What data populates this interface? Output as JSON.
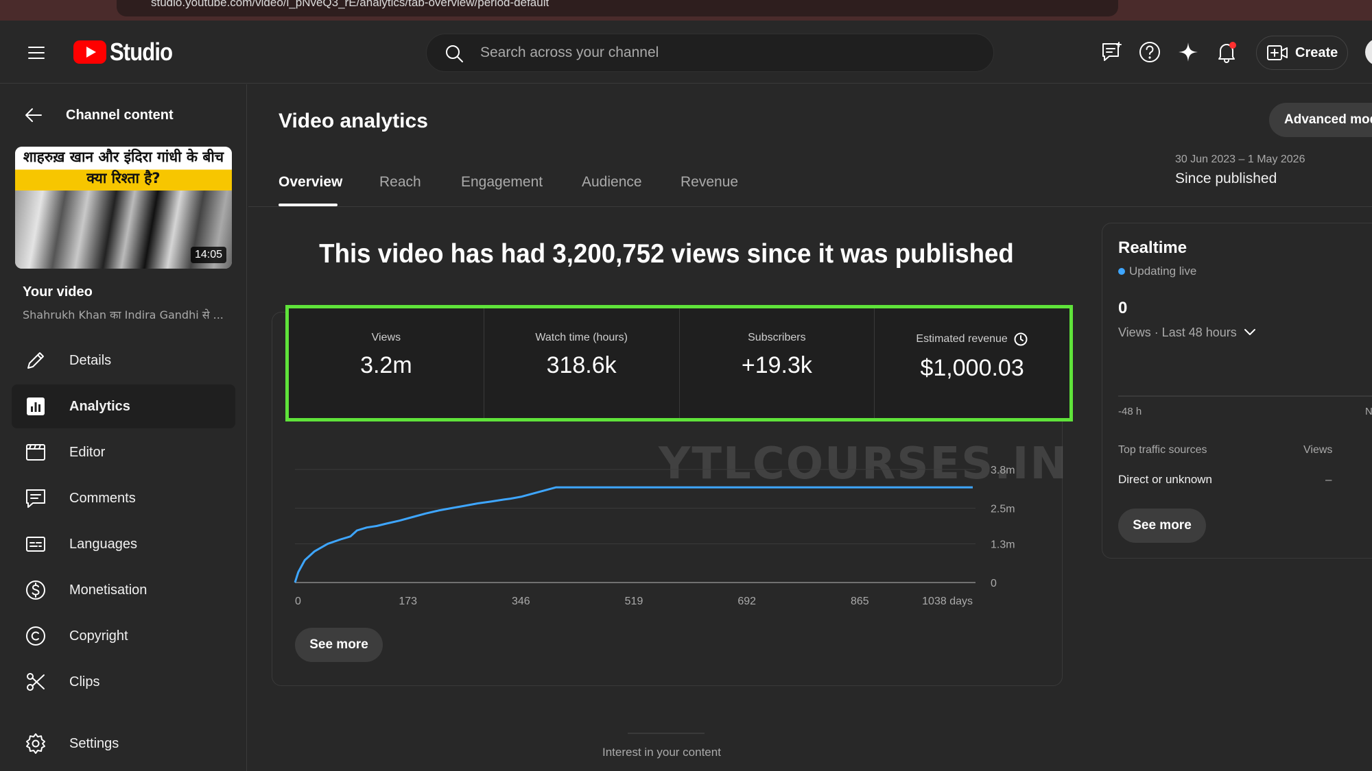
{
  "browser": {
    "url": "studio.youtube.com/video/l_pNveQ3_rE/analytics/tab-overview/period-default"
  },
  "header": {
    "logo_text": "Studio",
    "search_placeholder": "Search across your channel",
    "create_label": "Create",
    "brand_color": "#ff0000"
  },
  "sidebar": {
    "back_label": "Channel content",
    "thumbnail": {
      "title_line1": "शाहरुख़ खान और इंदिरा गांधी के बीच",
      "title_line2": "क्या रिश्ता है?",
      "duration": "14:05"
    },
    "your_video_label": "Your video",
    "video_title": "Shahrukh Khan का Indira Gandhi से ...",
    "items": [
      {
        "label": "Details",
        "icon": "pencil-icon",
        "active": false
      },
      {
        "label": "Analytics",
        "icon": "analytics-icon",
        "active": true
      },
      {
        "label": "Editor",
        "icon": "editor-icon",
        "active": false
      },
      {
        "label": "Comments",
        "icon": "comments-icon",
        "active": false
      },
      {
        "label": "Languages",
        "icon": "languages-icon",
        "active": false
      },
      {
        "label": "Monetisation",
        "icon": "monetisation-icon",
        "active": false
      },
      {
        "label": "Copyright",
        "icon": "copyright-icon",
        "active": false
      },
      {
        "label": "Clips",
        "icon": "scissors-icon",
        "active": false
      },
      {
        "label": "Settings",
        "icon": "gear-icon",
        "active": false
      }
    ]
  },
  "main": {
    "title": "Video analytics",
    "advanced_mode_label": "Advanced mod",
    "tabs": [
      {
        "label": "Overview",
        "active": true
      },
      {
        "label": "Reach",
        "active": false
      },
      {
        "label": "Engagement",
        "active": false
      },
      {
        "label": "Audience",
        "active": false
      },
      {
        "label": "Revenue",
        "active": false
      }
    ],
    "date_range": "30 Jun 2023 – 1 May 2026",
    "period": "Since published",
    "headline": "This video has had 3,200,752 views since it was published",
    "metrics": [
      {
        "label": "Views",
        "value": "3.2m"
      },
      {
        "label": "Watch time (hours)",
        "value": "318.6k"
      },
      {
        "label": "Subscribers",
        "value": "+19.3k"
      },
      {
        "label": "Estimated revenue",
        "value": "$1,000.03"
      }
    ],
    "see_more_label": "See more",
    "watermark": "YTLCOURSES.IN",
    "interest_label": "Interest in your content"
  },
  "chart_data": {
    "type": "line",
    "x_tick_labels": [
      "0",
      "173",
      "346",
      "519",
      "692",
      "865",
      "1038 days"
    ],
    "x_ticks": [
      0,
      173,
      346,
      519,
      692,
      865,
      1038
    ],
    "y_tick_labels": [
      "3.8m",
      "2.5m",
      "1.3m",
      "0"
    ],
    "y_ticks": [
      3.8,
      2.5,
      1.3,
      0
    ],
    "xlim": [
      0,
      1038
    ],
    "ylim": [
      0,
      3.8
    ],
    "y_unit": "m",
    "line_color": "#3ea6ff",
    "series": [
      {
        "values_x": [
          0,
          5,
          15,
          30,
          50,
          70,
          85,
          95,
          110,
          125,
          140,
          160,
          180,
          200,
          220,
          240,
          260,
          280,
          300,
          320,
          330,
          346,
          400,
          500,
          600,
          700,
          800,
          900,
          1000,
          1038
        ],
        "values_y": [
          0,
          0.35,
          0.75,
          1.05,
          1.3,
          1.45,
          1.55,
          1.75,
          1.85,
          1.9,
          1.98,
          2.08,
          2.2,
          2.32,
          2.42,
          2.5,
          2.58,
          2.66,
          2.72,
          2.79,
          2.82,
          2.88,
          3.2,
          3.2,
          3.2,
          3.2,
          3.2,
          3.2,
          3.2,
          3.2
        ]
      }
    ]
  },
  "realtime": {
    "title": "Realtime",
    "status": "Updating live",
    "value": "0",
    "period": "Views · Last 48 hours",
    "axis_start": "-48 h",
    "axis_end": "N",
    "sources_label": "Top traffic sources",
    "views_label": "Views",
    "source_name": "Direct or unknown",
    "source_value": "–",
    "see_more_label": "See more"
  }
}
